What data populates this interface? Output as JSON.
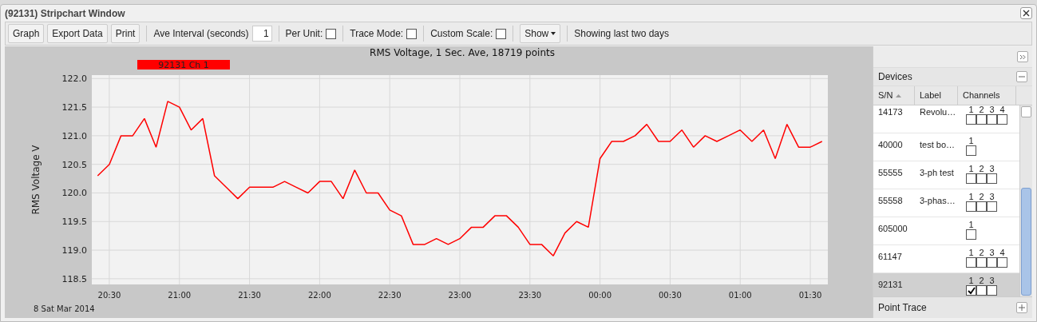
{
  "window": {
    "title": "(92131) Stripchart Window"
  },
  "toolbar": {
    "buttons": [
      "Graph",
      "Export Data",
      "Print"
    ],
    "ave_interval": {
      "label": "Ave Interval (seconds)",
      "value": "1"
    },
    "options": [
      {
        "label": "Per Unit:",
        "checked": false
      },
      {
        "label": "Trace Mode:",
        "checked": false
      },
      {
        "label": "Custom Scale:",
        "checked": false
      }
    ],
    "show_menu": "Show",
    "status": "Showing last two days"
  },
  "chart": {
    "date_label": "8 Sat Mar 2014",
    "chart_data": {
      "type": "line",
      "title": "RMS Voltage, 1 Sec. Ave, 18719 points",
      "ylabel": "RMS Voltage V",
      "grid": true,
      "categories": [
        null,
        "20:30",
        null,
        null,
        null,
        null,
        null,
        "21:00",
        null,
        null,
        null,
        null,
        null,
        "21:30",
        null,
        null,
        null,
        null,
        null,
        "22:00",
        null,
        null,
        null,
        null,
        null,
        "22:30",
        null,
        null,
        null,
        null,
        null,
        "23:00",
        null,
        null,
        null,
        null,
        null,
        "23:30",
        null,
        null,
        null,
        null,
        null,
        "00:00",
        null,
        null,
        null,
        null,
        null,
        "00:30",
        null,
        null,
        null,
        null,
        null,
        "01:00",
        null,
        null,
        null,
        null,
        null,
        "01:30",
        null
      ],
      "series": [
        {
          "name": "92131 Ch 1",
          "color": "#ff0000",
          "values": [
            120.3,
            120.5,
            121.0,
            121.0,
            121.3,
            120.8,
            121.6,
            121.5,
            121.1,
            121.3,
            120.3,
            120.1,
            119.9,
            120.1,
            120.1,
            120.1,
            120.2,
            120.1,
            120.0,
            120.2,
            120.2,
            119.9,
            120.4,
            120.0,
            120.0,
            119.7,
            119.6,
            119.1,
            119.1,
            119.2,
            119.1,
            119.2,
            119.4,
            119.4,
            119.6,
            119.6,
            119.4,
            119.1,
            119.1,
            118.9,
            119.3,
            119.5,
            119.4,
            120.6,
            120.9,
            120.9,
            121.0,
            121.2,
            120.9,
            120.9,
            121.1,
            120.8,
            121.0,
            120.9,
            121.0,
            121.1,
            120.9,
            121.1,
            120.6,
            121.2,
            120.8,
            120.8,
            120.9
          ]
        }
      ],
      "ylim": [
        118.4,
        122.06
      ],
      "yticks": [
        {
          "value": 118.5,
          "label": "118.5"
        },
        {
          "value": 119,
          "label": "119.0"
        },
        {
          "value": 119.5,
          "label": "119.5"
        },
        {
          "value": 120,
          "label": "120.0"
        },
        {
          "value": 120.5,
          "label": "120.5"
        },
        {
          "value": 121,
          "label": "121.0"
        },
        {
          "value": 121.5,
          "label": "121.5"
        },
        {
          "value": 122,
          "label": "122.0"
        }
      ]
    }
  },
  "side_panel": {
    "devices": {
      "title": "Devices",
      "expanded": true,
      "columns": [
        {
          "label": "S/N",
          "sorted": true
        },
        {
          "label": "Label",
          "sorted": false
        },
        {
          "label": "Channels",
          "sorted": false
        }
      ],
      "rows": [
        {
          "sn": "14173",
          "label": "Revolu…",
          "selected": false,
          "channels": [
            {
              "label": "1",
              "checked": false
            },
            {
              "label": "2",
              "checked": false
            },
            {
              "label": "3",
              "checked": false
            },
            {
              "label": "4",
              "checked": false
            }
          ]
        },
        {
          "sn": "40000",
          "label": "test bo…",
          "selected": false,
          "channels": [
            {
              "label": "1",
              "checked": false
            }
          ]
        },
        {
          "sn": "55555",
          "label": "3-ph test",
          "selected": false,
          "channels": [
            {
              "label": "1",
              "checked": false
            },
            {
              "label": "2",
              "checked": false
            },
            {
              "label": "3",
              "checked": false
            }
          ]
        },
        {
          "sn": "55558",
          "label": "3-phas…",
          "selected": false,
          "channels": [
            {
              "label": "1",
              "checked": false
            },
            {
              "label": "2",
              "checked": false
            },
            {
              "label": "3",
              "checked": false
            }
          ]
        },
        {
          "sn": "605000",
          "selected": false,
          "channels": [
            {
              "label": "1",
              "checked": false
            }
          ]
        },
        {
          "sn": "61147",
          "selected": false,
          "channels": [
            {
              "label": "1",
              "checked": false
            },
            {
              "label": "2",
              "checked": false
            },
            {
              "label": "3",
              "checked": false
            },
            {
              "label": "4",
              "checked": false
            }
          ]
        },
        {
          "sn": "92131",
          "selected": true,
          "channels": [
            {
              "label": "1",
              "checked": true
            },
            {
              "label": "2",
              "checked": false
            },
            {
              "label": "3",
              "checked": false
            }
          ]
        }
      ]
    },
    "point_trace": {
      "title": "Point Trace",
      "expanded": false
    }
  }
}
